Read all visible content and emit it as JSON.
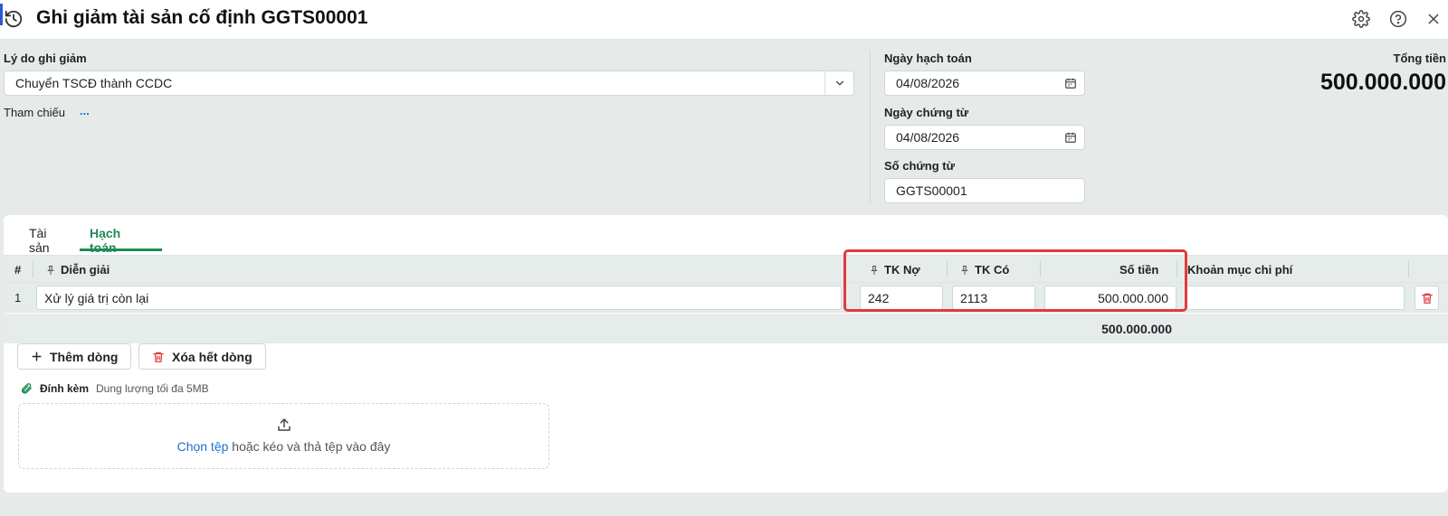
{
  "window": {
    "title": "Ghi giảm tài sản cố định GGTS00001"
  },
  "form": {
    "reason_label": "Lý do ghi giảm",
    "reason_value": "Chuyển TSCĐ thành CCDC",
    "reference_label": "Tham chiếu",
    "reference_link": "...",
    "posting_date_label": "Ngày hạch toán",
    "posting_date_value": "04/08/2026",
    "voucher_date_label": "Ngày chứng từ",
    "voucher_date_value": "04/08/2026",
    "voucher_no_label": "Số chứng từ",
    "voucher_no_value": "GGTS00001",
    "total_label": "Tổng tiền",
    "total_value": "500.000.000"
  },
  "tabs": [
    {
      "label": "Tài sản",
      "active": false
    },
    {
      "label": "Hạch toán",
      "active": true
    }
  ],
  "grid": {
    "columns": {
      "index": "#",
      "description": "Diễn giải",
      "debit": "TK Nợ",
      "credit": "TK Có",
      "amount": "Số tiền",
      "cost_item": "Khoản mục chi phí"
    },
    "rows": [
      {
        "index": "1",
        "description": "Xử lý giá trị còn lại",
        "debit": "242",
        "credit": "2113",
        "amount": "500.000.000",
        "cost_item": ""
      }
    ],
    "footer_total": "500.000.000"
  },
  "actions": {
    "add_row": "Thêm dòng",
    "delete_all_rows": "Xóa hết dòng"
  },
  "attachment": {
    "label": "Đính kèm",
    "hint": "Dung lượng tối đa 5MB",
    "choose_file": "Chọn tệp",
    "drop_text": "hoặc kéo và thả tệp vào đây"
  },
  "colors": {
    "accent": "#1e8c55",
    "highlight": "#e23b3b",
    "link": "#1f6fd1"
  }
}
